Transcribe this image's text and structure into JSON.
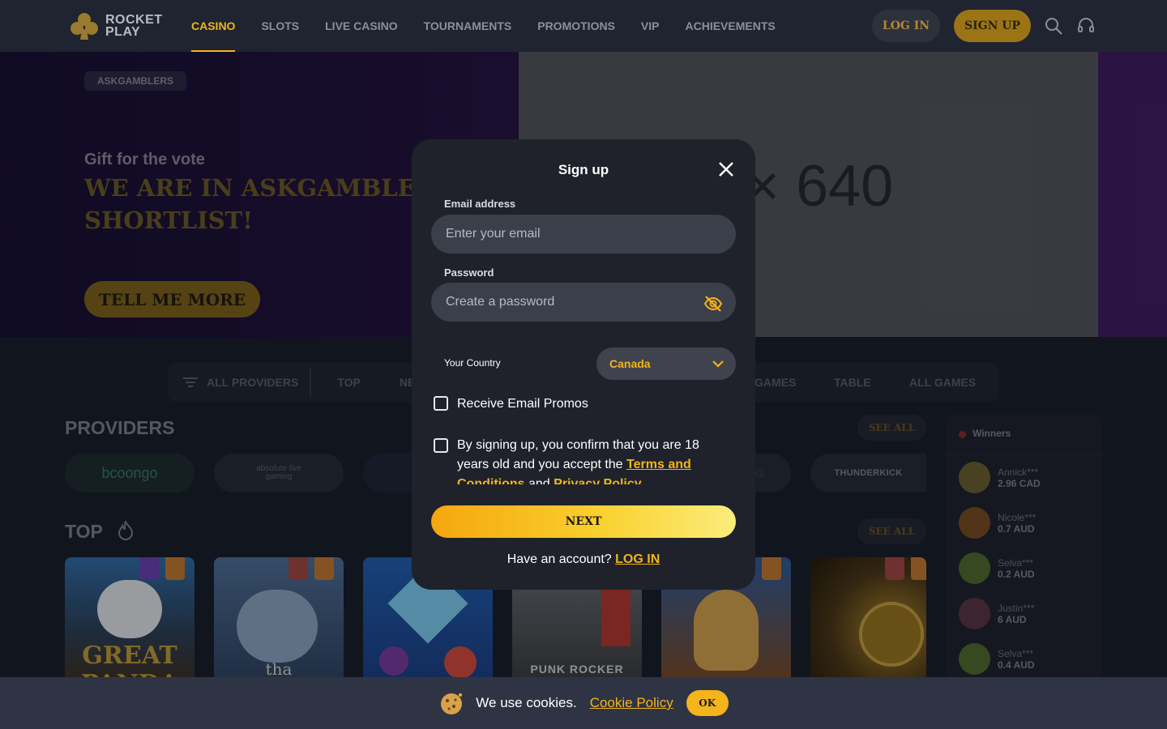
{
  "header": {
    "logo_line1": "ROCKET",
    "logo_line2": "PLAY",
    "nav": [
      "CASINO",
      "SLOTS",
      "LIVE CASINO",
      "TOURNAMENTS",
      "PROMOTIONS",
      "VIP",
      "ACHIEVEMENTS"
    ],
    "active_nav": "CASINO",
    "login_label": "LOG IN",
    "signup_label": "SIGN UP"
  },
  "banner": {
    "chip": "ASKGAMBLERS",
    "subtitle": "Gift for the vote",
    "title_line1": "WE ARE IN ASKGAMBLERS",
    "title_line2": "SHORTLIST!",
    "cta_label": "TELL ME MORE",
    "placeholder_text": "0 × 640"
  },
  "tabs": {
    "all_providers": "ALL PROVIDERS",
    "items": [
      "TOP",
      "NE",
      "GAMES",
      "TABLE",
      "ALL GAMES"
    ]
  },
  "providers": {
    "title": "PROVIDERS",
    "see_all": "SEE ALL",
    "items": [
      "bcoongo",
      "absolute live gaming",
      "",
      "",
      "",
      "G",
      "THUNDERKICK"
    ]
  },
  "top": {
    "title": "TOP",
    "see_all": "SEE ALL",
    "games": [
      "GREAT PANDA",
      "tha",
      "",
      "PUNK ROCKER",
      "",
      ""
    ]
  },
  "winners": {
    "title": "Winners",
    "items": [
      {
        "name": "Annick***",
        "amount": "2.96 CAD"
      },
      {
        "name": "Nicole***",
        "amount": "0.7 AUD"
      },
      {
        "name": "Selva***",
        "amount": "0.2 AUD"
      },
      {
        "name": "Justin***",
        "amount": "6 AUD"
      },
      {
        "name": "Selva***",
        "amount": "0.4 AUD"
      }
    ]
  },
  "modal": {
    "title": "Sign up",
    "email_label": "Email address",
    "email_placeholder": "Enter your email",
    "password_label": "Password",
    "password_placeholder": "Create a password",
    "country_label": "Your Country",
    "country_value": "Canada",
    "promos_label": "Receive Email Promos",
    "terms_prefix": "By signing up, you confirm that you are 18 years old and you accept the",
    "terms_link": "Terms and Conditions",
    "terms_and": "and",
    "privacy_link": "Privacy Policy",
    "next_label": "NEXT",
    "have_account": "Have an account?",
    "login_link": "LOG IN"
  },
  "cookie": {
    "text": "We use cookies.",
    "link": "Cookie Policy",
    "ok": "OK"
  },
  "colors": {
    "accent": "#f3b41c",
    "background": "#161b26",
    "modal_bg": "#1f222b"
  }
}
